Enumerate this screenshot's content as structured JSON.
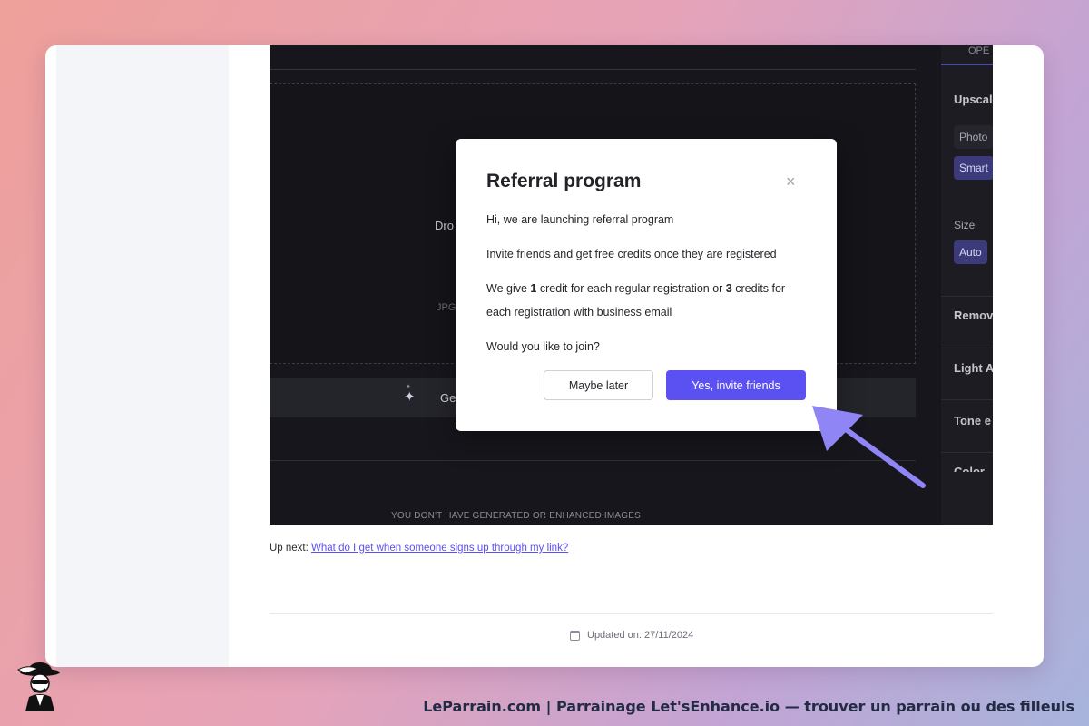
{
  "screenshot": {
    "drop_text": "Dro",
    "formats_text": "JPG",
    "generate_label": "Ge",
    "empty_state": "YOU DON'T HAVE GENERATED OR ENHANCED IMAGES",
    "right_panel": {
      "tab": "OPE",
      "sections": [
        "Upscal",
        "Remov",
        "Light A",
        "Tone e",
        "Color"
      ],
      "upscale_options": [
        "Photo",
        "Smart"
      ],
      "size_label": "Size",
      "size_value": "Auto"
    }
  },
  "modal": {
    "title": "Referral program",
    "line1": "Hi, we are launching referral program",
    "line2": "Invite friends and get free credits once they are registered",
    "line3_pre": "We give ",
    "line3_n1": "1",
    "line3_mid": " credit for each regular registration or ",
    "line3_n2": "3",
    "line3_post": " credits for",
    "line4": "each registration with business email",
    "line5": "Would you like to join?",
    "later_label": "Maybe later",
    "yes_label": "Yes, invite friends",
    "close_glyph": "×"
  },
  "page": {
    "upnext_prefix": "Up next: ",
    "upnext_link": "What do I get when someone signs up through my link?",
    "updated": "Updated on: 27/11/2024"
  },
  "footer": {
    "caption": "LeParrain.com | Parrainage Let'sEnhance.io — trouver un parrain ou des filleuls"
  },
  "colors": {
    "accent": "#5b51f2",
    "arrow": "#8f85f5"
  },
  "icons": [
    "close-icon",
    "sparkle-icon",
    "calendar-icon",
    "arrow-pointer-icon",
    "leparrain-logo"
  ]
}
